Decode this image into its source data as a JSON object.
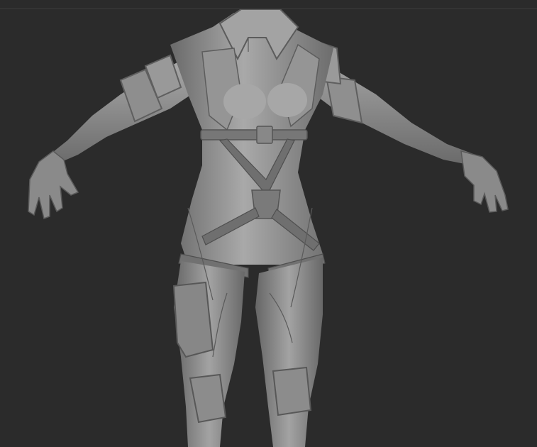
{
  "app": {
    "window_title": ""
  },
  "viewport": {
    "background_color": "#2b2b2b",
    "divider_color": "#3d3d3d",
    "model_base_color": "#8f8f8f",
    "model_shadow_color": "#5e5e5e",
    "model_highlight_color": "#b9b9b9",
    "strap_color": "#6f6f6f"
  }
}
